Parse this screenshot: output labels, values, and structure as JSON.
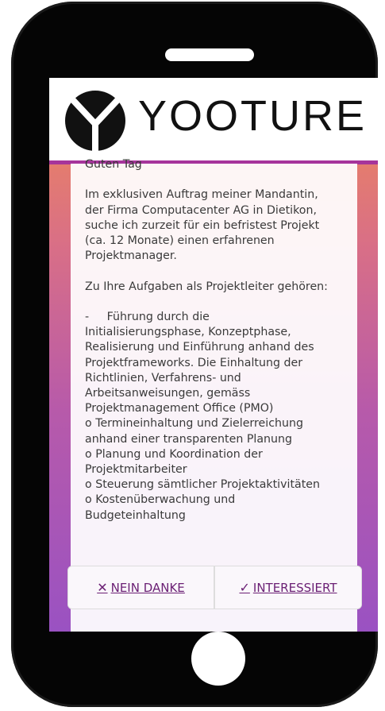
{
  "app": {
    "name": "YOOTURE"
  },
  "job_text": {
    "greeting_partial": "Guten Tag",
    "paragraph1": "Im exklusiven Auftrag meiner Mandantin,\nder Firma Computacenter AG in Dietikon,\nsuche ich zurzeit für ein befristest Projekt\n(ca. 12 Monate) einen erfahrenen\nProjektmanager.",
    "paragraph2": "Zu Ihre Aufgaben als Projektleiter gehören:",
    "paragraph3": "-     Führung durch die\nInitialisierungsphase, Konzeptphase,\nRealisierung und Einführung anhand des\nProjektframeworks. Die Einhaltung der\nRichtlinien, Verfahrens- und\nArbeitsanweisungen, gemäss\nProjektmanagement Office (PMO)\no Termineinhaltung und Zielerreichung\nanhand einer transparenten Planung\no Planung und Koordination der\nProjektmitarbeiter\no Steuerung sämtlicher Projektaktivitäten\no Kostenüberwachung und\nBudgeteinhaltung"
  },
  "actions": {
    "decline_label": "NEIN DANKE",
    "accept_label": "INTERESSIERT",
    "decline_icon": "close-icon",
    "accept_icon": "check-icon"
  },
  "colors": {
    "accent": "#a6349b",
    "button_text": "#6a1f74"
  }
}
